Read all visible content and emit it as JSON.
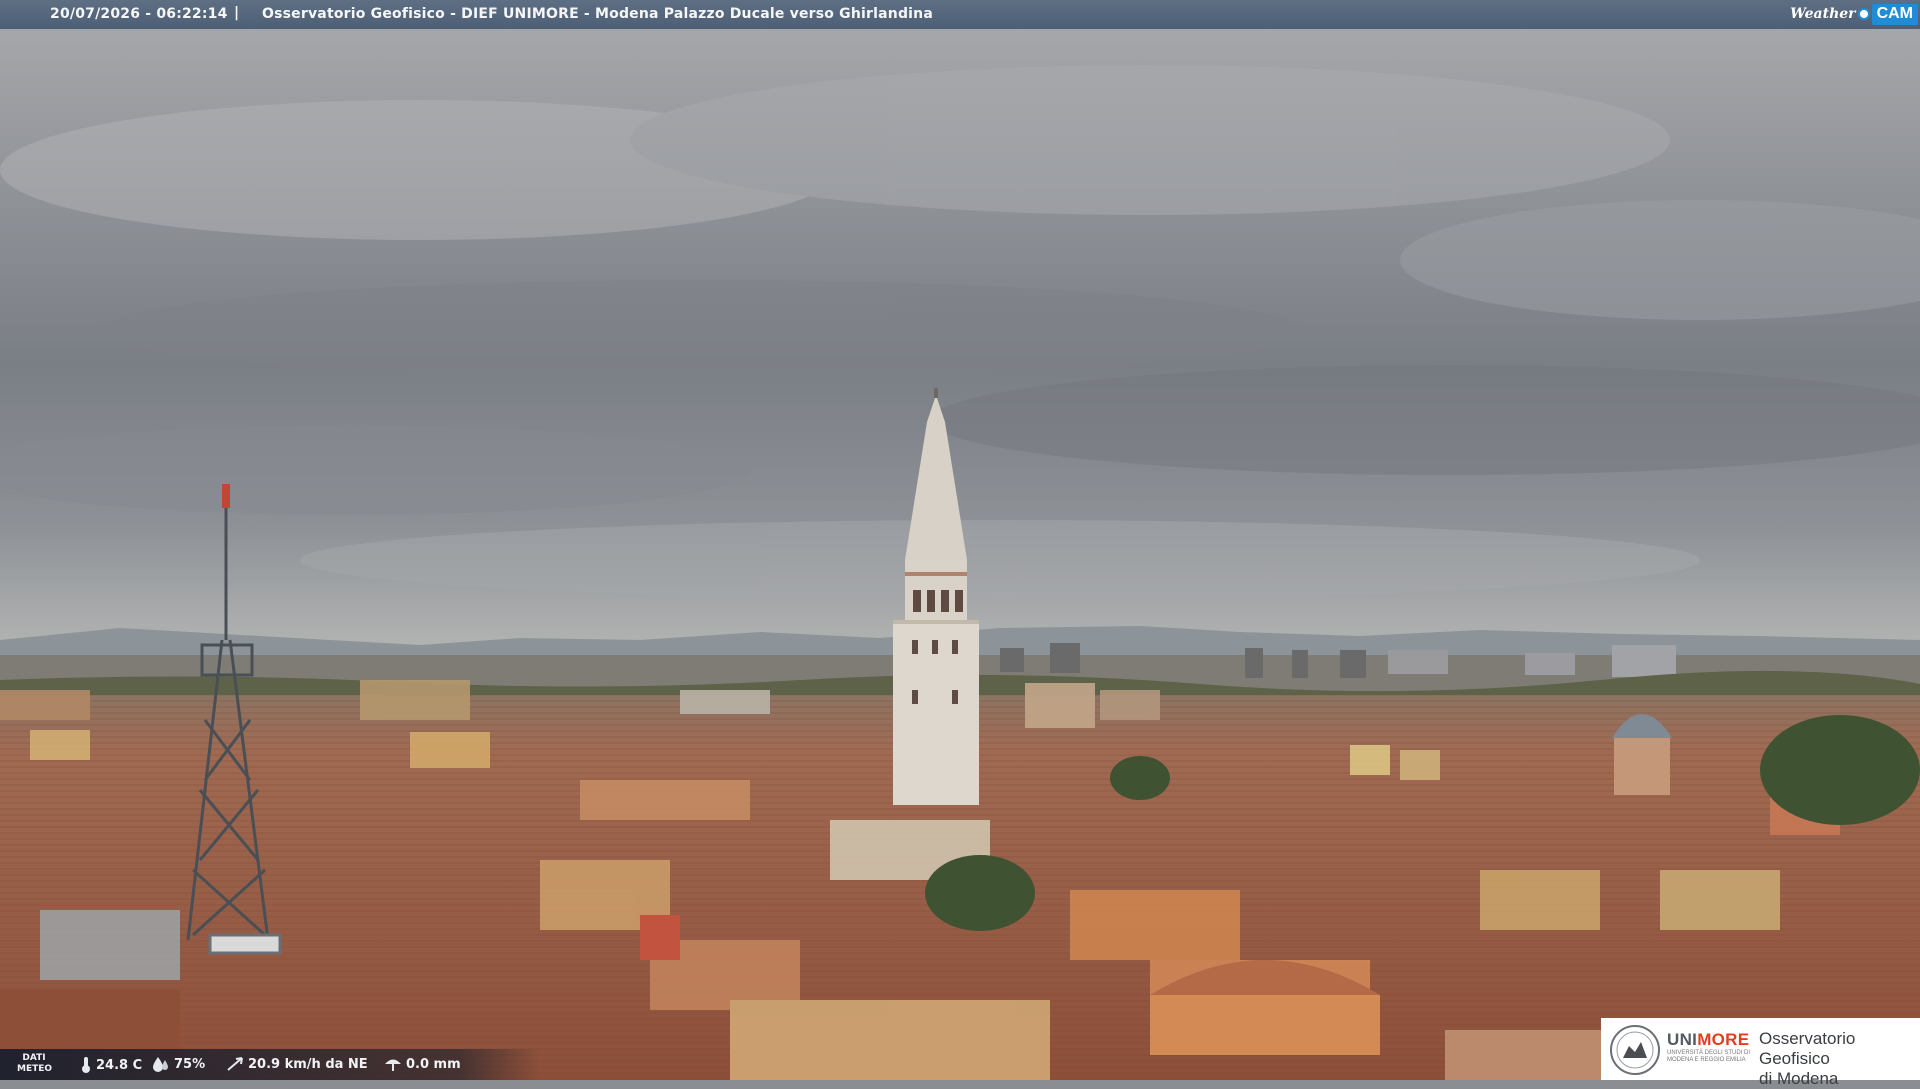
{
  "header": {
    "timestamp": "20/07/2026 - 06:22:14",
    "separator": "|",
    "caption": "Osservatorio Geofisico - DIEF UNIMORE - Modena Palazzo Ducale verso Ghirlandina",
    "brand_weather": "Weather",
    "brand_cam": "CAM",
    "brand_colors": {
      "bar": "#56687e",
      "cam": "#1f8dd6"
    }
  },
  "weather": {
    "label_line1": "DATI",
    "label_line2": "METEO",
    "temperature": "24.8 C",
    "humidity": "75%",
    "wind": "20.9 km/h da NE",
    "rain": "0.0 mm",
    "icons": [
      "thermometer-icon",
      "humidity-icon",
      "wind-icon",
      "rain-icon"
    ]
  },
  "logo": {
    "uni_prefix": "UNI",
    "uni_suffix": "MORE",
    "uni_sub": "Università degli studi di Modena e Reggio Emilia",
    "observatory_line1": "Osservatorio Geofisico",
    "observatory_line2": "di Modena",
    "accent": "#e2401c"
  },
  "scene": {
    "subject": "Ghirlandina tower",
    "colors": {
      "sky": "#8c9096",
      "roofs": "#a5634a",
      "stone": "#dcd7cf"
    }
  }
}
